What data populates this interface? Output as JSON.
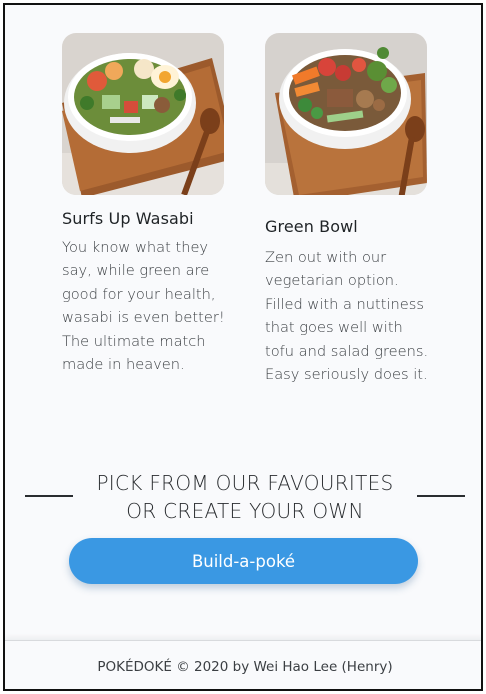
{
  "cards": [
    {
      "title": "Surfs Up Wasabi",
      "description": "You know what they say, while green are good for your health, wasabi is even better! The ultimate match made in heaven.",
      "image": "poke-bowl-salmon-photo"
    },
    {
      "title": "Green Bowl",
      "description": "Zen out with our vegetarian option. Filled with a nuttiness that goes well with tofu and salad greens. Easy seriously does it.",
      "image": "poke-bowl-vegetarian-photo"
    }
  ],
  "cta": {
    "heading_line1": "PICK FROM OUR FAVOURITES",
    "heading_line2": "OR CREATE YOUR OWN",
    "button_label": "Build-a-poké"
  },
  "footer": {
    "text": "POKÉDOKÉ © 2020 by Wei Hao Lee (Henry)"
  },
  "colors": {
    "accent": "#3a98e3",
    "background": "#f9fafc",
    "text": "#1f2326"
  }
}
